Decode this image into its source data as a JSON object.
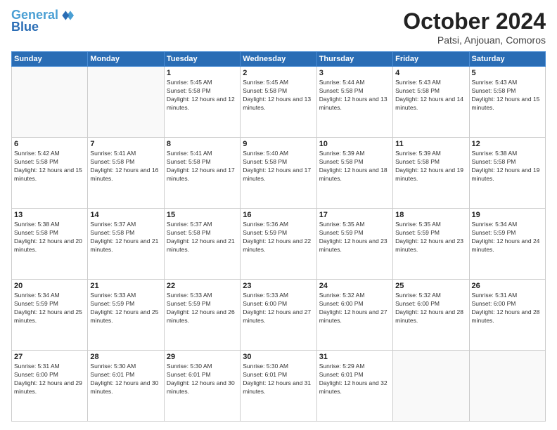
{
  "logo": {
    "line1": "General",
    "line2": "Blue"
  },
  "title": "October 2024",
  "location": "Patsi, Anjouan, Comoros",
  "weekdays": [
    "Sunday",
    "Monday",
    "Tuesday",
    "Wednesday",
    "Thursday",
    "Friday",
    "Saturday"
  ],
  "weeks": [
    [
      {
        "day": "",
        "sunrise": "",
        "sunset": "",
        "daylight": ""
      },
      {
        "day": "",
        "sunrise": "",
        "sunset": "",
        "daylight": ""
      },
      {
        "day": "1",
        "sunrise": "Sunrise: 5:45 AM",
        "sunset": "Sunset: 5:58 PM",
        "daylight": "Daylight: 12 hours and 12 minutes."
      },
      {
        "day": "2",
        "sunrise": "Sunrise: 5:45 AM",
        "sunset": "Sunset: 5:58 PM",
        "daylight": "Daylight: 12 hours and 13 minutes."
      },
      {
        "day": "3",
        "sunrise": "Sunrise: 5:44 AM",
        "sunset": "Sunset: 5:58 PM",
        "daylight": "Daylight: 12 hours and 13 minutes."
      },
      {
        "day": "4",
        "sunrise": "Sunrise: 5:43 AM",
        "sunset": "Sunset: 5:58 PM",
        "daylight": "Daylight: 12 hours and 14 minutes."
      },
      {
        "day": "5",
        "sunrise": "Sunrise: 5:43 AM",
        "sunset": "Sunset: 5:58 PM",
        "daylight": "Daylight: 12 hours and 15 minutes."
      }
    ],
    [
      {
        "day": "6",
        "sunrise": "Sunrise: 5:42 AM",
        "sunset": "Sunset: 5:58 PM",
        "daylight": "Daylight: 12 hours and 15 minutes."
      },
      {
        "day": "7",
        "sunrise": "Sunrise: 5:41 AM",
        "sunset": "Sunset: 5:58 PM",
        "daylight": "Daylight: 12 hours and 16 minutes."
      },
      {
        "day": "8",
        "sunrise": "Sunrise: 5:41 AM",
        "sunset": "Sunset: 5:58 PM",
        "daylight": "Daylight: 12 hours and 17 minutes."
      },
      {
        "day": "9",
        "sunrise": "Sunrise: 5:40 AM",
        "sunset": "Sunset: 5:58 PM",
        "daylight": "Daylight: 12 hours and 17 minutes."
      },
      {
        "day": "10",
        "sunrise": "Sunrise: 5:39 AM",
        "sunset": "Sunset: 5:58 PM",
        "daylight": "Daylight: 12 hours and 18 minutes."
      },
      {
        "day": "11",
        "sunrise": "Sunrise: 5:39 AM",
        "sunset": "Sunset: 5:58 PM",
        "daylight": "Daylight: 12 hours and 19 minutes."
      },
      {
        "day": "12",
        "sunrise": "Sunrise: 5:38 AM",
        "sunset": "Sunset: 5:58 PM",
        "daylight": "Daylight: 12 hours and 19 minutes."
      }
    ],
    [
      {
        "day": "13",
        "sunrise": "Sunrise: 5:38 AM",
        "sunset": "Sunset: 5:58 PM",
        "daylight": "Daylight: 12 hours and 20 minutes."
      },
      {
        "day": "14",
        "sunrise": "Sunrise: 5:37 AM",
        "sunset": "Sunset: 5:58 PM",
        "daylight": "Daylight: 12 hours and 21 minutes."
      },
      {
        "day": "15",
        "sunrise": "Sunrise: 5:37 AM",
        "sunset": "Sunset: 5:58 PM",
        "daylight": "Daylight: 12 hours and 21 minutes."
      },
      {
        "day": "16",
        "sunrise": "Sunrise: 5:36 AM",
        "sunset": "Sunset: 5:59 PM",
        "daylight": "Daylight: 12 hours and 22 minutes."
      },
      {
        "day": "17",
        "sunrise": "Sunrise: 5:35 AM",
        "sunset": "Sunset: 5:59 PM",
        "daylight": "Daylight: 12 hours and 23 minutes."
      },
      {
        "day": "18",
        "sunrise": "Sunrise: 5:35 AM",
        "sunset": "Sunset: 5:59 PM",
        "daylight": "Daylight: 12 hours and 23 minutes."
      },
      {
        "day": "19",
        "sunrise": "Sunrise: 5:34 AM",
        "sunset": "Sunset: 5:59 PM",
        "daylight": "Daylight: 12 hours and 24 minutes."
      }
    ],
    [
      {
        "day": "20",
        "sunrise": "Sunrise: 5:34 AM",
        "sunset": "Sunset: 5:59 PM",
        "daylight": "Daylight: 12 hours and 25 minutes."
      },
      {
        "day": "21",
        "sunrise": "Sunrise: 5:33 AM",
        "sunset": "Sunset: 5:59 PM",
        "daylight": "Daylight: 12 hours and 25 minutes."
      },
      {
        "day": "22",
        "sunrise": "Sunrise: 5:33 AM",
        "sunset": "Sunset: 5:59 PM",
        "daylight": "Daylight: 12 hours and 26 minutes."
      },
      {
        "day": "23",
        "sunrise": "Sunrise: 5:33 AM",
        "sunset": "Sunset: 6:00 PM",
        "daylight": "Daylight: 12 hours and 27 minutes."
      },
      {
        "day": "24",
        "sunrise": "Sunrise: 5:32 AM",
        "sunset": "Sunset: 6:00 PM",
        "daylight": "Daylight: 12 hours and 27 minutes."
      },
      {
        "day": "25",
        "sunrise": "Sunrise: 5:32 AM",
        "sunset": "Sunset: 6:00 PM",
        "daylight": "Daylight: 12 hours and 28 minutes."
      },
      {
        "day": "26",
        "sunrise": "Sunrise: 5:31 AM",
        "sunset": "Sunset: 6:00 PM",
        "daylight": "Daylight: 12 hours and 28 minutes."
      }
    ],
    [
      {
        "day": "27",
        "sunrise": "Sunrise: 5:31 AM",
        "sunset": "Sunset: 6:00 PM",
        "daylight": "Daylight: 12 hours and 29 minutes."
      },
      {
        "day": "28",
        "sunrise": "Sunrise: 5:30 AM",
        "sunset": "Sunset: 6:01 PM",
        "daylight": "Daylight: 12 hours and 30 minutes."
      },
      {
        "day": "29",
        "sunrise": "Sunrise: 5:30 AM",
        "sunset": "Sunset: 6:01 PM",
        "daylight": "Daylight: 12 hours and 30 minutes."
      },
      {
        "day": "30",
        "sunrise": "Sunrise: 5:30 AM",
        "sunset": "Sunset: 6:01 PM",
        "daylight": "Daylight: 12 hours and 31 minutes."
      },
      {
        "day": "31",
        "sunrise": "Sunrise: 5:29 AM",
        "sunset": "Sunset: 6:01 PM",
        "daylight": "Daylight: 12 hours and 32 minutes."
      },
      {
        "day": "",
        "sunrise": "",
        "sunset": "",
        "daylight": ""
      },
      {
        "day": "",
        "sunrise": "",
        "sunset": "",
        "daylight": ""
      }
    ]
  ]
}
